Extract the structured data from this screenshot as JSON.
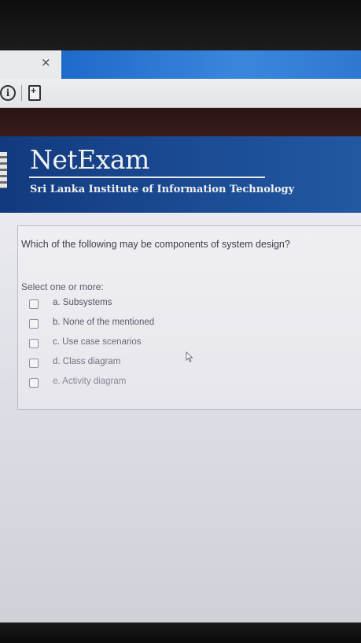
{
  "browser": {
    "tab_close_glyph": "×",
    "info_icon": "info-icon",
    "page_icon": "page-add-icon"
  },
  "header": {
    "brand": "NetExam",
    "subtitle": "Sri Lanka Institute of Information Technology"
  },
  "question": {
    "text": "Which of the following may be components of system design?",
    "prompt": "Select one or more:",
    "options": [
      {
        "label": "a. Subsystems",
        "checked": false
      },
      {
        "label": "b. None of the mentioned",
        "checked": false
      },
      {
        "label": "c. Use case scenarios",
        "checked": false
      },
      {
        "label": "d. Class diagram",
        "checked": false
      },
      {
        "label": "e. Activity diagram",
        "checked": false
      }
    ]
  },
  "colors": {
    "header_bg": "#1a4a92",
    "tab_accent": "#2e78d2"
  }
}
